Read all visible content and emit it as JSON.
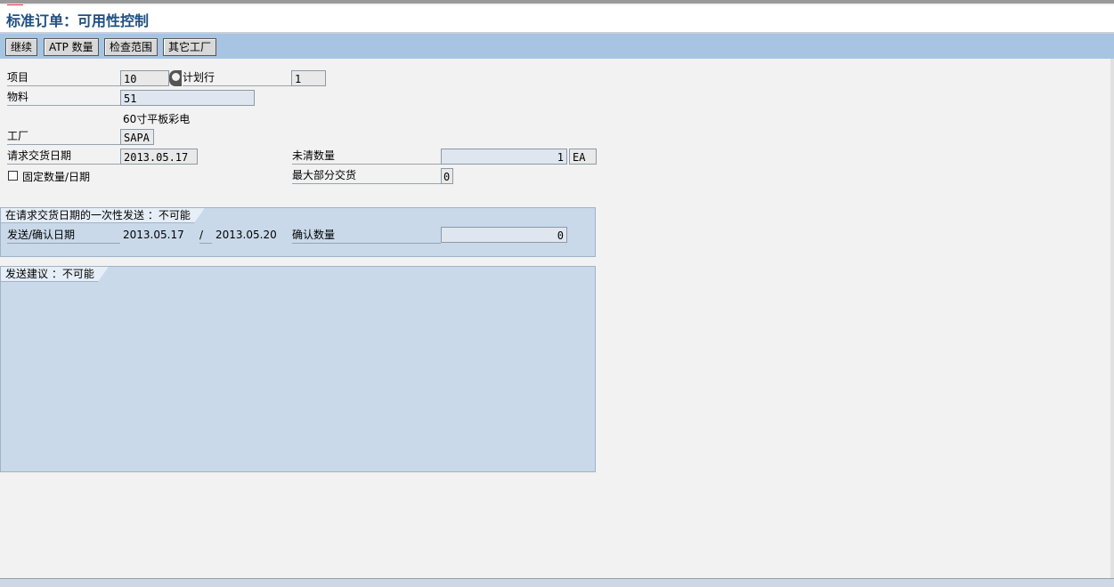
{
  "title": "标准订单：可用性控制",
  "toolbar": {
    "continue": "继续",
    "atp_qty": "ATP 数量",
    "check_scope": "检查范围",
    "other_plant": "其它工厂"
  },
  "form": {
    "item_label": "项目",
    "item_value": "10",
    "schedule_line_label": "计划行",
    "schedule_line_value": "1",
    "material_label": "物料",
    "material_value": "51",
    "material_desc": "60寸平板彩电",
    "plant_label": "工厂",
    "plant_value": "SAPA",
    "req_date_label": "请求交货日期",
    "req_date_value": "2013.05.17",
    "open_qty_label": "未清数量",
    "open_qty_value": "1",
    "open_qty_unit": "EA",
    "fixed_label": "固定数量/日期",
    "max_partial_label": "最大部分交货",
    "max_partial_value": "0"
  },
  "one_time": {
    "title": "在请求交货日期的一次性发送 ：不可能",
    "ship_confirm_label": "发送/确认日期",
    "ship_date": "2013.05.17",
    "separator": "/",
    "confirm_date": "2013.05.20",
    "confirm_qty_label": "确认数量",
    "confirm_qty_value": "0"
  },
  "proposal": {
    "title": "发送建议 ：不可能"
  }
}
